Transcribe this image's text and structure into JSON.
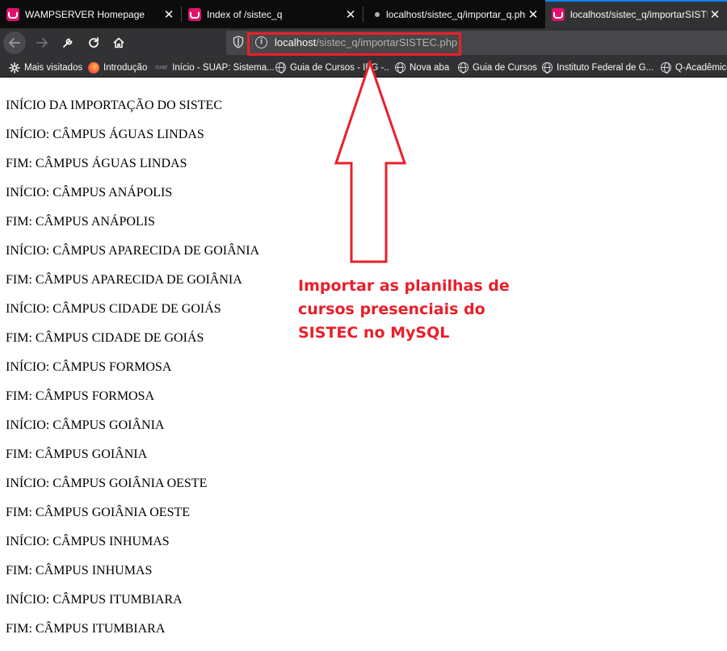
{
  "tabs": [
    {
      "title": "WAMPSERVER Homepage",
      "icon": "wampserver-icon",
      "active": false
    },
    {
      "title": "Index of /sistec_q",
      "icon": "wampserver-icon",
      "active": false
    },
    {
      "title": "localhost/sistec_q/importar_q.php",
      "icon": "dot-icon",
      "active": false
    },
    {
      "title": "localhost/sistec_q/importarSISTEC.php",
      "icon": "wampserver-icon",
      "active": true
    }
  ],
  "address_bar": {
    "host": "localhost",
    "path": "/sistec_q/importarSISTEC.php"
  },
  "bookmarks": [
    {
      "label": "Mais visitados",
      "icon": "gear-icon"
    },
    {
      "label": "Introdução",
      "icon": "firefox-icon"
    },
    {
      "label": "Início - SUAP: Sistema...",
      "icon": "suap-icon",
      "prefix": "suap"
    },
    {
      "label": "Guia de Cursos - IFG -...",
      "icon": "globe-icon"
    },
    {
      "label": "Nova aba",
      "icon": "globe-icon"
    },
    {
      "label": "Guia de Cursos",
      "icon": "globe-icon"
    },
    {
      "label": "Instituto Federal de G...",
      "icon": "globe-icon"
    },
    {
      "label": "Q-Acadêmico",
      "icon": "globe-icon"
    }
  ],
  "page_lines": [
    "INÍCIO DA IMPORTAÇÃO DO SISTEC",
    "INÍCIO: CÂMPUS ÁGUAS LINDAS",
    "FIM: CÂMPUS ÁGUAS LINDAS",
    "INÍCIO: CÂMPUS ANÁPOLIS",
    "FIM: CÂMPUS ANÁPOLIS",
    "INÍCIO: CÂMPUS APARECIDA DE GOIÂNIA",
    "FIM: CÂMPUS APARECIDA DE GOIÂNIA",
    "INÍCIO: CÂMPUS CIDADE DE GOIÁS",
    "FIM: CÂMPUS CIDADE DE GOIÁS",
    "INÍCIO: CÂMPUS FORMOSA",
    "FIM: CÂMPUS FORMOSA",
    "INÍCIO: CÂMPUS GOIÂNIA",
    "FIM: CÂMPUS GOIÂNIA",
    "INÍCIO: CÂMPUS GOIÂNIA OESTE",
    "FIM: CÂMPUS GOIÂNIA OESTE",
    "INÍCIO: CÂMPUS INHUMAS",
    "FIM: CÂMPUS INHUMAS",
    "INÍCIO: CÂMPUS ITUMBIARA",
    "FIM: CÂMPUS ITUMBIARA"
  ],
  "annotation": {
    "lines": [
      "Importar as planilhas de",
      "cursos presenciais do",
      "SISTEC no MySQL"
    ],
    "color": "#e8202a"
  },
  "colors": {
    "chrome_dark": "#0c0c0d",
    "toolbar": "#323234",
    "url_field": "#474749",
    "accent": "#0a84ff"
  }
}
